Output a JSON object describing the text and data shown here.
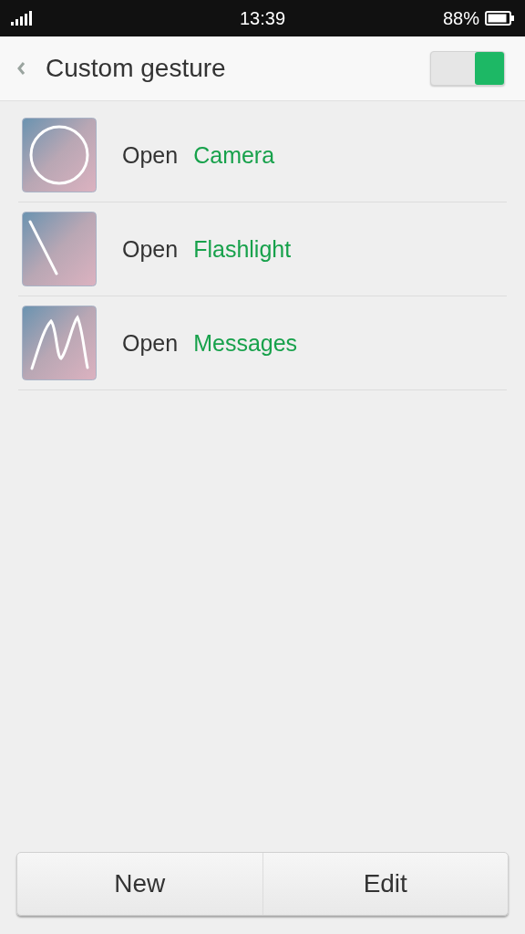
{
  "status_bar": {
    "time": "13:39",
    "battery": "88%"
  },
  "header": {
    "title": "Custom gesture",
    "switch": {
      "on": true
    }
  },
  "gestures": [
    {
      "kind": "circle",
      "action": "Open",
      "target": "Camera"
    },
    {
      "kind": "line",
      "action": "Open",
      "target": "Flashlight"
    },
    {
      "kind": "m",
      "action": "Open",
      "target": "Messages"
    }
  ],
  "buttons": [
    "New",
    "Edit"
  ]
}
